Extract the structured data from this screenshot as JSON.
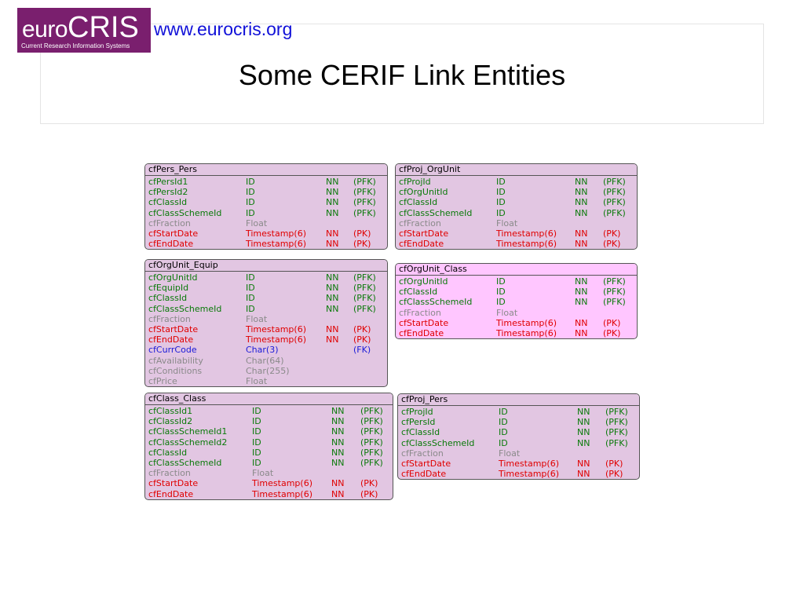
{
  "header": {
    "logo_prefix": "euro",
    "logo_main": "CRIS",
    "logo_tagline": "Current Research Information Systems",
    "url": "www.eurocris.org"
  },
  "slide": {
    "title": "Some CERIF Link Entities"
  },
  "colors": {
    "logo_bg": "#7a1f6e",
    "url": "#1010d8",
    "pfk": "#0a7a0a",
    "pk": "#e00000",
    "fk": "#1a1ad8",
    "plain": "#8a8a8a",
    "entity_fill": "#e2c6e2",
    "entity_highlight": "#ffc6ff"
  },
  "entities": [
    {
      "name": "cfPers_Pers",
      "highlight": false,
      "rows": [
        {
          "field": "cfPersId1",
          "type": "ID",
          "nn": "NN",
          "key": "(PFK)",
          "kind": "pfk"
        },
        {
          "field": "cfPersId2",
          "type": "ID",
          "nn": "NN",
          "key": "(PFK)",
          "kind": "pfk"
        },
        {
          "field": "cfClassId",
          "type": "ID",
          "nn": "NN",
          "key": "(PFK)",
          "kind": "pfk"
        },
        {
          "field": "cfClassSchemeId",
          "type": "ID",
          "nn": "NN",
          "key": "(PFK)",
          "kind": "pfk"
        },
        {
          "field": "cfFraction",
          "type": "Float",
          "nn": "",
          "key": "",
          "kind": "none"
        },
        {
          "field": "cfStartDate",
          "type": "Timestamp(6)",
          "nn": "NN",
          "key": "(PK)",
          "kind": "pk"
        },
        {
          "field": "cfEndDate",
          "type": "Timestamp(6)",
          "nn": "NN",
          "key": "(PK)",
          "kind": "pk"
        }
      ]
    },
    {
      "name": "cfProj_OrgUnit",
      "highlight": false,
      "rows": [
        {
          "field": "cfProjId",
          "type": "ID",
          "nn": "NN",
          "key": "(PFK)",
          "kind": "pfk"
        },
        {
          "field": "cfOrgUnitId",
          "type": "ID",
          "nn": "NN",
          "key": "(PFK)",
          "kind": "pfk"
        },
        {
          "field": "cfClassId",
          "type": "ID",
          "nn": "NN",
          "key": "(PFK)",
          "kind": "pfk"
        },
        {
          "field": "cfClassSchemeId",
          "type": "ID",
          "nn": "NN",
          "key": "(PFK)",
          "kind": "pfk"
        },
        {
          "field": "cfFraction",
          "type": "Float",
          "nn": "",
          "key": "",
          "kind": "none"
        },
        {
          "field": "cfStartDate",
          "type": "Timestamp(6)",
          "nn": "NN",
          "key": "(PK)",
          "kind": "pk"
        },
        {
          "field": "cfEndDate",
          "type": "Timestamp(6)",
          "nn": "NN",
          "key": "(PK)",
          "kind": "pk"
        }
      ]
    },
    {
      "name": "cfOrgUnit_Equip",
      "highlight": false,
      "rows": [
        {
          "field": "cfOrgUnitId",
          "type": "ID",
          "nn": "NN",
          "key": "(PFK)",
          "kind": "pfk"
        },
        {
          "field": "cfEquipId",
          "type": "ID",
          "nn": "NN",
          "key": "(PFK)",
          "kind": "pfk"
        },
        {
          "field": "cfClassId",
          "type": "ID",
          "nn": "NN",
          "key": "(PFK)",
          "kind": "pfk"
        },
        {
          "field": "cfClassSchemeId",
          "type": "ID",
          "nn": "NN",
          "key": "(PFK)",
          "kind": "pfk"
        },
        {
          "field": "cfFraction",
          "type": "Float",
          "nn": "",
          "key": "",
          "kind": "none"
        },
        {
          "field": "cfStartDate",
          "type": "Timestamp(6)",
          "nn": "NN",
          "key": "(PK)",
          "kind": "pk"
        },
        {
          "field": "cfEndDate",
          "type": "Timestamp(6)",
          "nn": "NN",
          "key": "(PK)",
          "kind": "pk"
        },
        {
          "field": "cfCurrCode",
          "type": "Char(3)",
          "nn": "",
          "key": "(FK)",
          "kind": "fk"
        },
        {
          "field": "cfAvailability",
          "type": "Char(64)",
          "nn": "",
          "key": "",
          "kind": "none"
        },
        {
          "field": "cfConditions",
          "type": "Char(255)",
          "nn": "",
          "key": "",
          "kind": "none"
        },
        {
          "field": "cfPrice",
          "type": "Float",
          "nn": "",
          "key": "",
          "kind": "none"
        }
      ]
    },
    {
      "name": "cfOrgUnit_Class",
      "highlight": true,
      "rows": [
        {
          "field": "cfOrgUnitId",
          "type": "ID",
          "nn": "NN",
          "key": "(PFK)",
          "kind": "pfk"
        },
        {
          "field": "cfClassId",
          "type": "ID",
          "nn": "NN",
          "key": "(PFK)",
          "kind": "pfk"
        },
        {
          "field": "cfClassSchemeId",
          "type": "ID",
          "nn": "NN",
          "key": "(PFK)",
          "kind": "pfk"
        },
        {
          "field": "cfFraction",
          "type": "Float",
          "nn": "",
          "key": "",
          "kind": "none"
        },
        {
          "field": "cfStartDate",
          "type": "Timestamp(6)",
          "nn": "NN",
          "key": "(PK)",
          "kind": "pk"
        },
        {
          "field": "cfEndDate",
          "type": "Timestamp(6)",
          "nn": "NN",
          "key": "(PK)",
          "kind": "pk"
        }
      ]
    },
    {
      "name": "cfClass_Class",
      "highlight": false,
      "rows": [
        {
          "field": "cfClassId1",
          "type": "ID",
          "nn": "NN",
          "key": "(PFK)",
          "kind": "pfk"
        },
        {
          "field": "cfClassId2",
          "type": "ID",
          "nn": "NN",
          "key": "(PFK)",
          "kind": "pfk"
        },
        {
          "field": "cfClassSchemeId1",
          "type": "ID",
          "nn": "NN",
          "key": "(PFK)",
          "kind": "pfk"
        },
        {
          "field": "cfClassSchemeId2",
          "type": "ID",
          "nn": "NN",
          "key": "(PFK)",
          "kind": "pfk"
        },
        {
          "field": "cfClassId",
          "type": "ID",
          "nn": "NN",
          "key": "(PFK)",
          "kind": "pfk"
        },
        {
          "field": "cfClassSchemeId",
          "type": "ID",
          "nn": "NN",
          "key": "(PFK)",
          "kind": "pfk"
        },
        {
          "field": "cfFraction",
          "type": "Float",
          "nn": "",
          "key": "",
          "kind": "none"
        },
        {
          "field": "cfStartDate",
          "type": "Timestamp(6)",
          "nn": "NN",
          "key": "(PK)",
          "kind": "pk"
        },
        {
          "field": "cfEndDate",
          "type": "Timestamp(6)",
          "nn": "NN",
          "key": "(PK)",
          "kind": "pk"
        }
      ]
    },
    {
      "name": "cfProj_Pers",
      "highlight": false,
      "rows": [
        {
          "field": "cfProjId",
          "type": "ID",
          "nn": "NN",
          "key": "(PFK)",
          "kind": "pfk"
        },
        {
          "field": "cfPersId",
          "type": "ID",
          "nn": "NN",
          "key": "(PFK)",
          "kind": "pfk"
        },
        {
          "field": "cfClassId",
          "type": "ID",
          "nn": "NN",
          "key": "(PFK)",
          "kind": "pfk"
        },
        {
          "field": "cfClassSchemeId",
          "type": "ID",
          "nn": "NN",
          "key": "(PFK)",
          "kind": "pfk"
        },
        {
          "field": "cfFraction",
          "type": "Float",
          "nn": "",
          "key": "",
          "kind": "none"
        },
        {
          "field": "cfStartDate",
          "type": "Timestamp(6)",
          "nn": "NN",
          "key": "(PK)",
          "kind": "pk"
        },
        {
          "field": "cfEndDate",
          "type": "Timestamp(6)",
          "nn": "NN",
          "key": "(PK)",
          "kind": "pk"
        }
      ]
    }
  ]
}
